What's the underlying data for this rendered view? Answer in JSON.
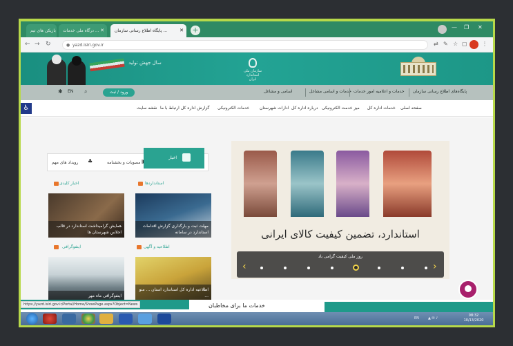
{
  "browser": {
    "tabs": [
      {
        "label": "بازیکن های تیم"
      },
      {
        "label": "درگاه ملی خدمات ... "
      },
      {
        "label": "پایگاه اطلاع رسانی سازمان ..."
      }
    ],
    "url": "yazd.isiri.gov.ir",
    "window_controls": {
      "minimize": "—",
      "restore": "❐",
      "close": "✕"
    }
  },
  "header": {
    "slogan": "سال جهش تولید",
    "emblem_text": "سازمان ملی استاندارد ایران"
  },
  "utility_nav": {
    "links": [
      "پایگاه‌های اطلاع رسانی سازمان",
      "خدمات و اعلامیه امور خدمات",
      "خدمات و اسامی مشاغل",
      "اسامی و مشاغل"
    ],
    "login": "ورود / ثبت",
    "language": "EN"
  },
  "main_menu": {
    "items": [
      "صفحه اصلی",
      "خدمات اداره کل",
      "میز خدمت الکترونیکی",
      "درباره اداره کل",
      "ادارات شهرستان",
      "خدمات الکترونیکی",
      "گزارش اداره کل",
      "ارتباط با ما",
      "نقشه سایت"
    ]
  },
  "slider": {
    "caption": "استاندارد، تضمین کیفیت کالای ایرانی",
    "current_title": "روز ملی کیفیت گرامی باد",
    "dot_count": 8,
    "active_dot": 4
  },
  "tabs_box": {
    "selected": "اخبار",
    "links": [
      "مصوبات و بخشنامه",
      "رویداد های مهم"
    ]
  },
  "cards": [
    {
      "category": "استانداردها",
      "caption": "مهلت ثبت و بارگذاری گزارش اقدامات استاندارد در سامانه"
    },
    {
      "category": "اخبار کلیدی",
      "caption": "همایش گرامیداشت استاندارد در قالب اجلاس شهرستان ها"
    },
    {
      "category": "اطلاعیه و آگهی",
      "caption": "اطلاعیه اداره کل استاندارد استان ... منو ..."
    },
    {
      "category": "اینفوگرافی",
      "caption": "اینفوگرافی ماه مهر"
    }
  ],
  "lower": {
    "section_title": "خدمات ما برای مخاطبان"
  },
  "status_bar": {
    "url": "https://yazd.isiri.gov.ir/Portal/Home/ShowPage.aspx?Object=News"
  },
  "taskbar": {
    "tray_lang": "EN",
    "time": "08:32",
    "date": "10/13/2020"
  }
}
